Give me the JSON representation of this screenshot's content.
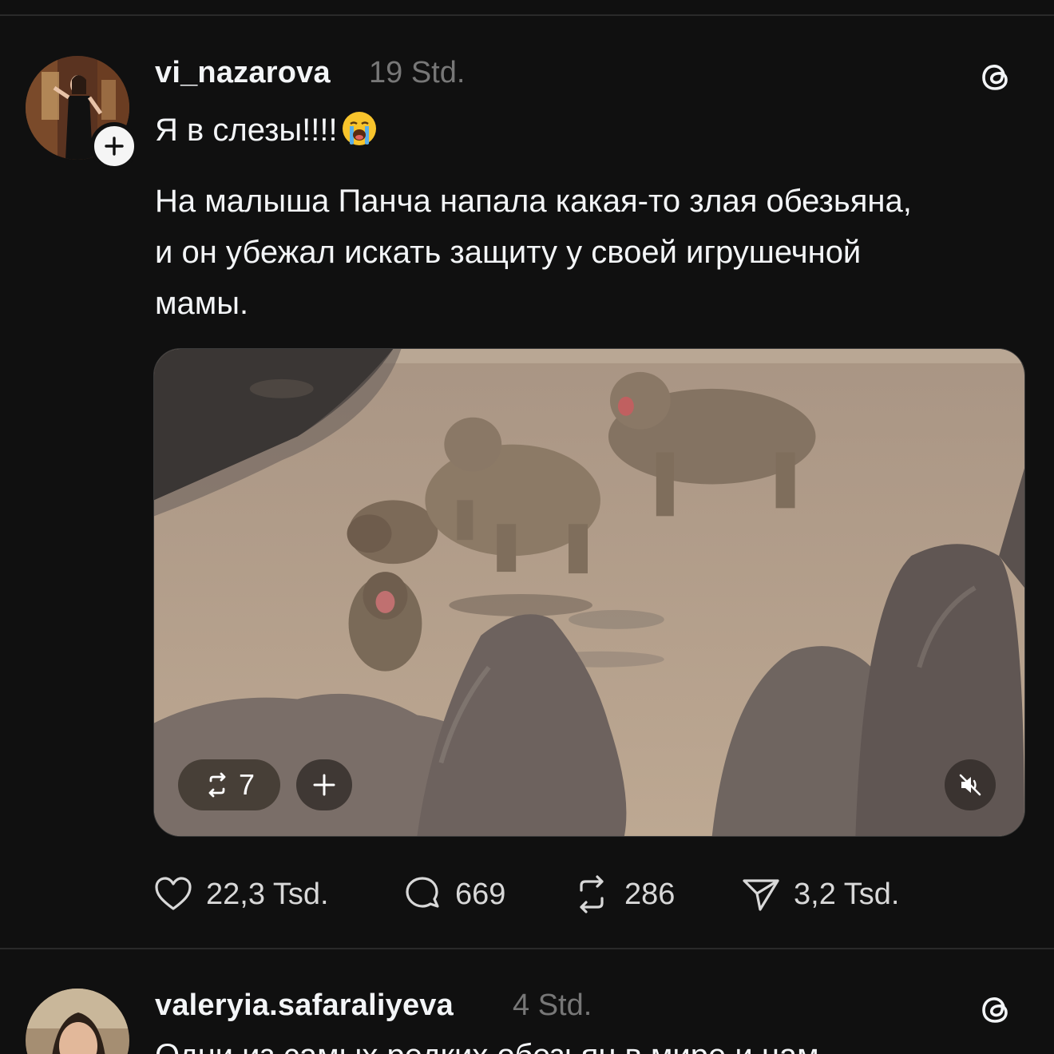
{
  "posts": [
    {
      "username": "vi_nazarova",
      "time": "19 Std.",
      "lines": [
        "Я в слезы!!!!",
        "На малыша Панча напала какая-то злая обезьяна,",
        "и он убежал искать защиту у своей игрушечной",
        "мамы."
      ],
      "emoji": "loudly-crying-face",
      "media": {
        "remix_count": "7",
        "muted": true
      },
      "actions": {
        "likes": "22,3 Tsd.",
        "replies": "669",
        "reposts": "286",
        "shares": "3,2 Tsd."
      }
    },
    {
      "username": "valeryia.safaraliyeva",
      "time": "4 Std.",
      "preview_text": "Одни из самых редких обезьян в мире и нам"
    }
  ],
  "icons": {
    "app": "threads-icon",
    "follow": "plus-icon",
    "like": "heart-icon",
    "reply": "comment-icon",
    "repost": "repost-icon",
    "share": "send-icon",
    "mute": "speaker-muted-icon"
  },
  "colors": {
    "background": "#101010",
    "text": "#f3f5f7",
    "secondary": "#777777"
  }
}
